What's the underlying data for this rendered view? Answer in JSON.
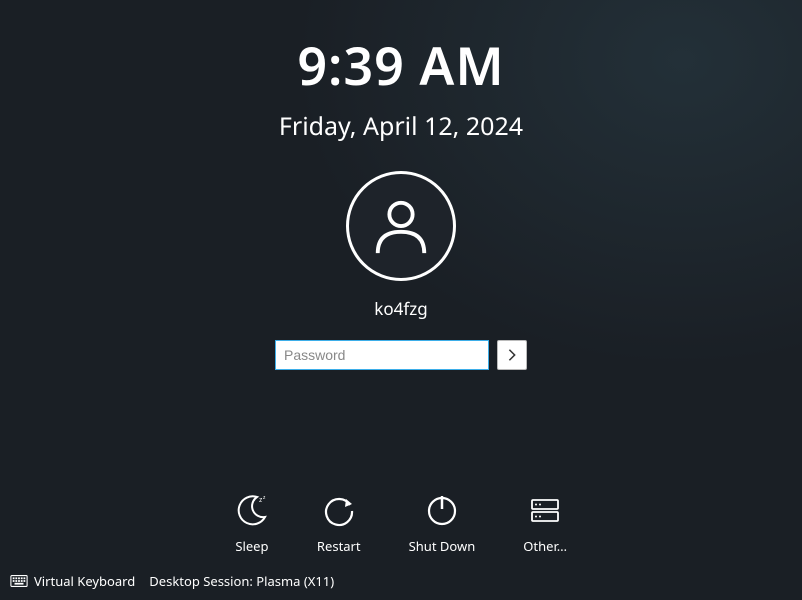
{
  "clock": {
    "time": "9:39 AM",
    "date": "Friday, April 12, 2024"
  },
  "user": {
    "name": "ko4fzg"
  },
  "password": {
    "placeholder": "Password"
  },
  "actions": {
    "sleep": "Sleep",
    "restart": "Restart",
    "shutdown": "Shut Down",
    "other": "Other…"
  },
  "bottom": {
    "virtual_keyboard": "Virtual Keyboard",
    "session_label": "Desktop Session: Plasma (X11)"
  }
}
